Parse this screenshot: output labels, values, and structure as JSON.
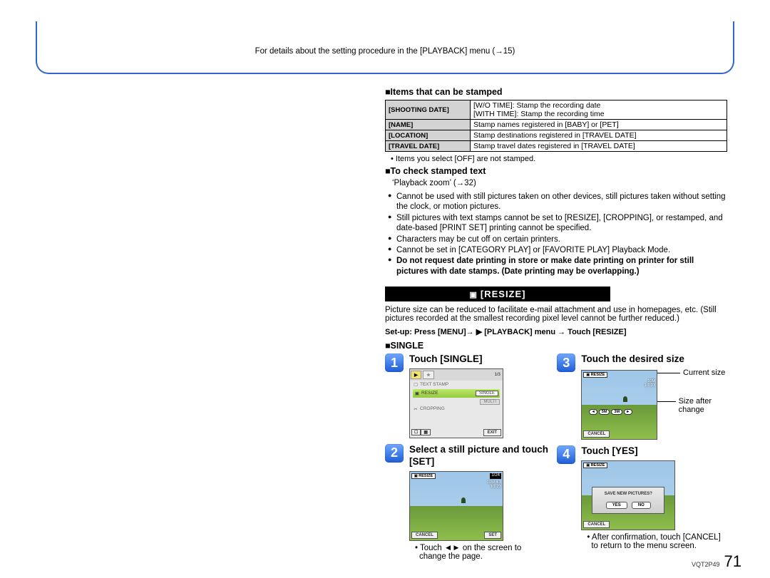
{
  "top_note": "For details about the setting procedure in the [PLAYBACK] menu (→15)",
  "heading_stamp": "■Items that can be stamped",
  "table": {
    "shooting_date": {
      "label": "[SHOOTING DATE]",
      "c1": "[W/O TIME]:   Stamp the recording date",
      "c2": "[WITH TIME]: Stamp the recording time"
    },
    "name": {
      "label": "[NAME]",
      "c": "Stamp names registered in [BABY] or [PET]"
    },
    "loc": {
      "label": "[LOCATION]",
      "c": "Stamp destinations registered in [TRAVEL DATE]"
    },
    "travel": {
      "label": "[TRAVEL DATE]",
      "c": "Stamp travel dates registered in [TRAVEL DATE]"
    }
  },
  "off_note": " • Items you select [OFF] are not stamped.",
  "heading_check": "■To check stamped text",
  "playback_zoom": "‘Playback zoom’ (→32)",
  "bullets": [
    "Cannot be used with still pictures taken on other devices, still pictures taken without setting the clock, or motion pictures.",
    "Still pictures with text stamps cannot be set to [RESIZE], [CROPPING], or restamped, and date-based [PRINT SET] printing cannot be specified.",
    "Characters may be cut off on certain printers.",
    "Cannot be set in [CATEGORY PLAY] or [FAVORITE PLAY] Playback Mode."
  ],
  "bullet_bold": "Do not request date printing in store or make date printing on printer for still pictures with date stamps. (Date printing may be overlapping.)",
  "resize_bar": "[RESIZE]",
  "resize_para": "Picture size can be reduced to facilitate e-mail attachment and use in homepages, etc. (Still pictures recorded at the smallest recording pixel level cannot be further reduced.)",
  "setup_line": "Set-up: Press [MENU]→ ▶ [PLAYBACK] menu → Touch [RESIZE]",
  "single_head": "■SINGLE",
  "steps": {
    "s1": {
      "title": "Touch [SINGLE]"
    },
    "s2": {
      "title": "Select a still picture and touch [SET]",
      "note": " • Touch ◄► on the screen to change the page."
    },
    "s3": {
      "title": "Touch the desired size",
      "call1": "Current size",
      "call2": "Size after change"
    },
    "s4": {
      "title": "Touch [YES]",
      "note": " • After confirmation, touch [CANCEL] to return to the menu screen."
    }
  },
  "ui": {
    "tab_yellow": "▶",
    "tab_gray": "★",
    "menu_textstamp": "TEXT STAMP",
    "menu_resize": "RESIZE",
    "menu_cropping": "CROPPING",
    "pill_single": "SINGLE",
    "pill_multi": "MULTI",
    "btn_exit": "EXIT",
    "btn_cancel": "CANCEL",
    "btn_set": "SET",
    "photo_tag": "RESIZE",
    "count": "1/24",
    "red1": "10M  4:3",
    "red2": "1/1.23",
    "sz_current": "10M",
    "sz1": "5M",
    "sz2": "3M",
    "dialog_q": "SAVE NEW PICTURES?",
    "yes": "YES",
    "no": "NO"
  },
  "page": {
    "doc": "VQT2P49",
    "num": "71"
  }
}
